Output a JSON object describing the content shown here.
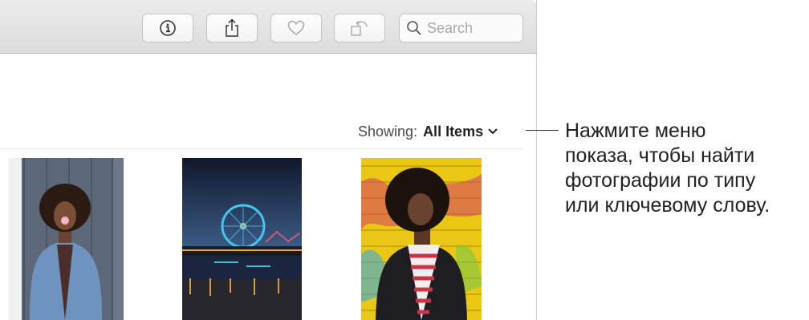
{
  "toolbar": {
    "info_button": {
      "icon": "info-icon"
    },
    "share_button": {
      "icon": "share-icon"
    },
    "favorite_button": {
      "icon": "heart-icon"
    },
    "rotate_button": {
      "icon": "rotate-icon"
    },
    "search": {
      "placeholder": "Search",
      "value": "",
      "icon": "search-icon"
    }
  },
  "filter": {
    "label": "Showing:",
    "value": "All Items",
    "icon": "chevron-down-icon"
  },
  "photos": [
    {
      "subject": "woman-blowing-bubble-gum",
      "background": "#5b6877"
    },
    {
      "subject": "pier-ferris-wheel-night",
      "background": "#1e2a44"
    },
    {
      "subject": "woman-yellow-wall",
      "background": "#e6c419"
    }
  ],
  "callout": {
    "lines": [
      "Нажмите меню",
      "показа, чтобы найти",
      "фотографии по типу",
      "или ключевому слову."
    ]
  }
}
